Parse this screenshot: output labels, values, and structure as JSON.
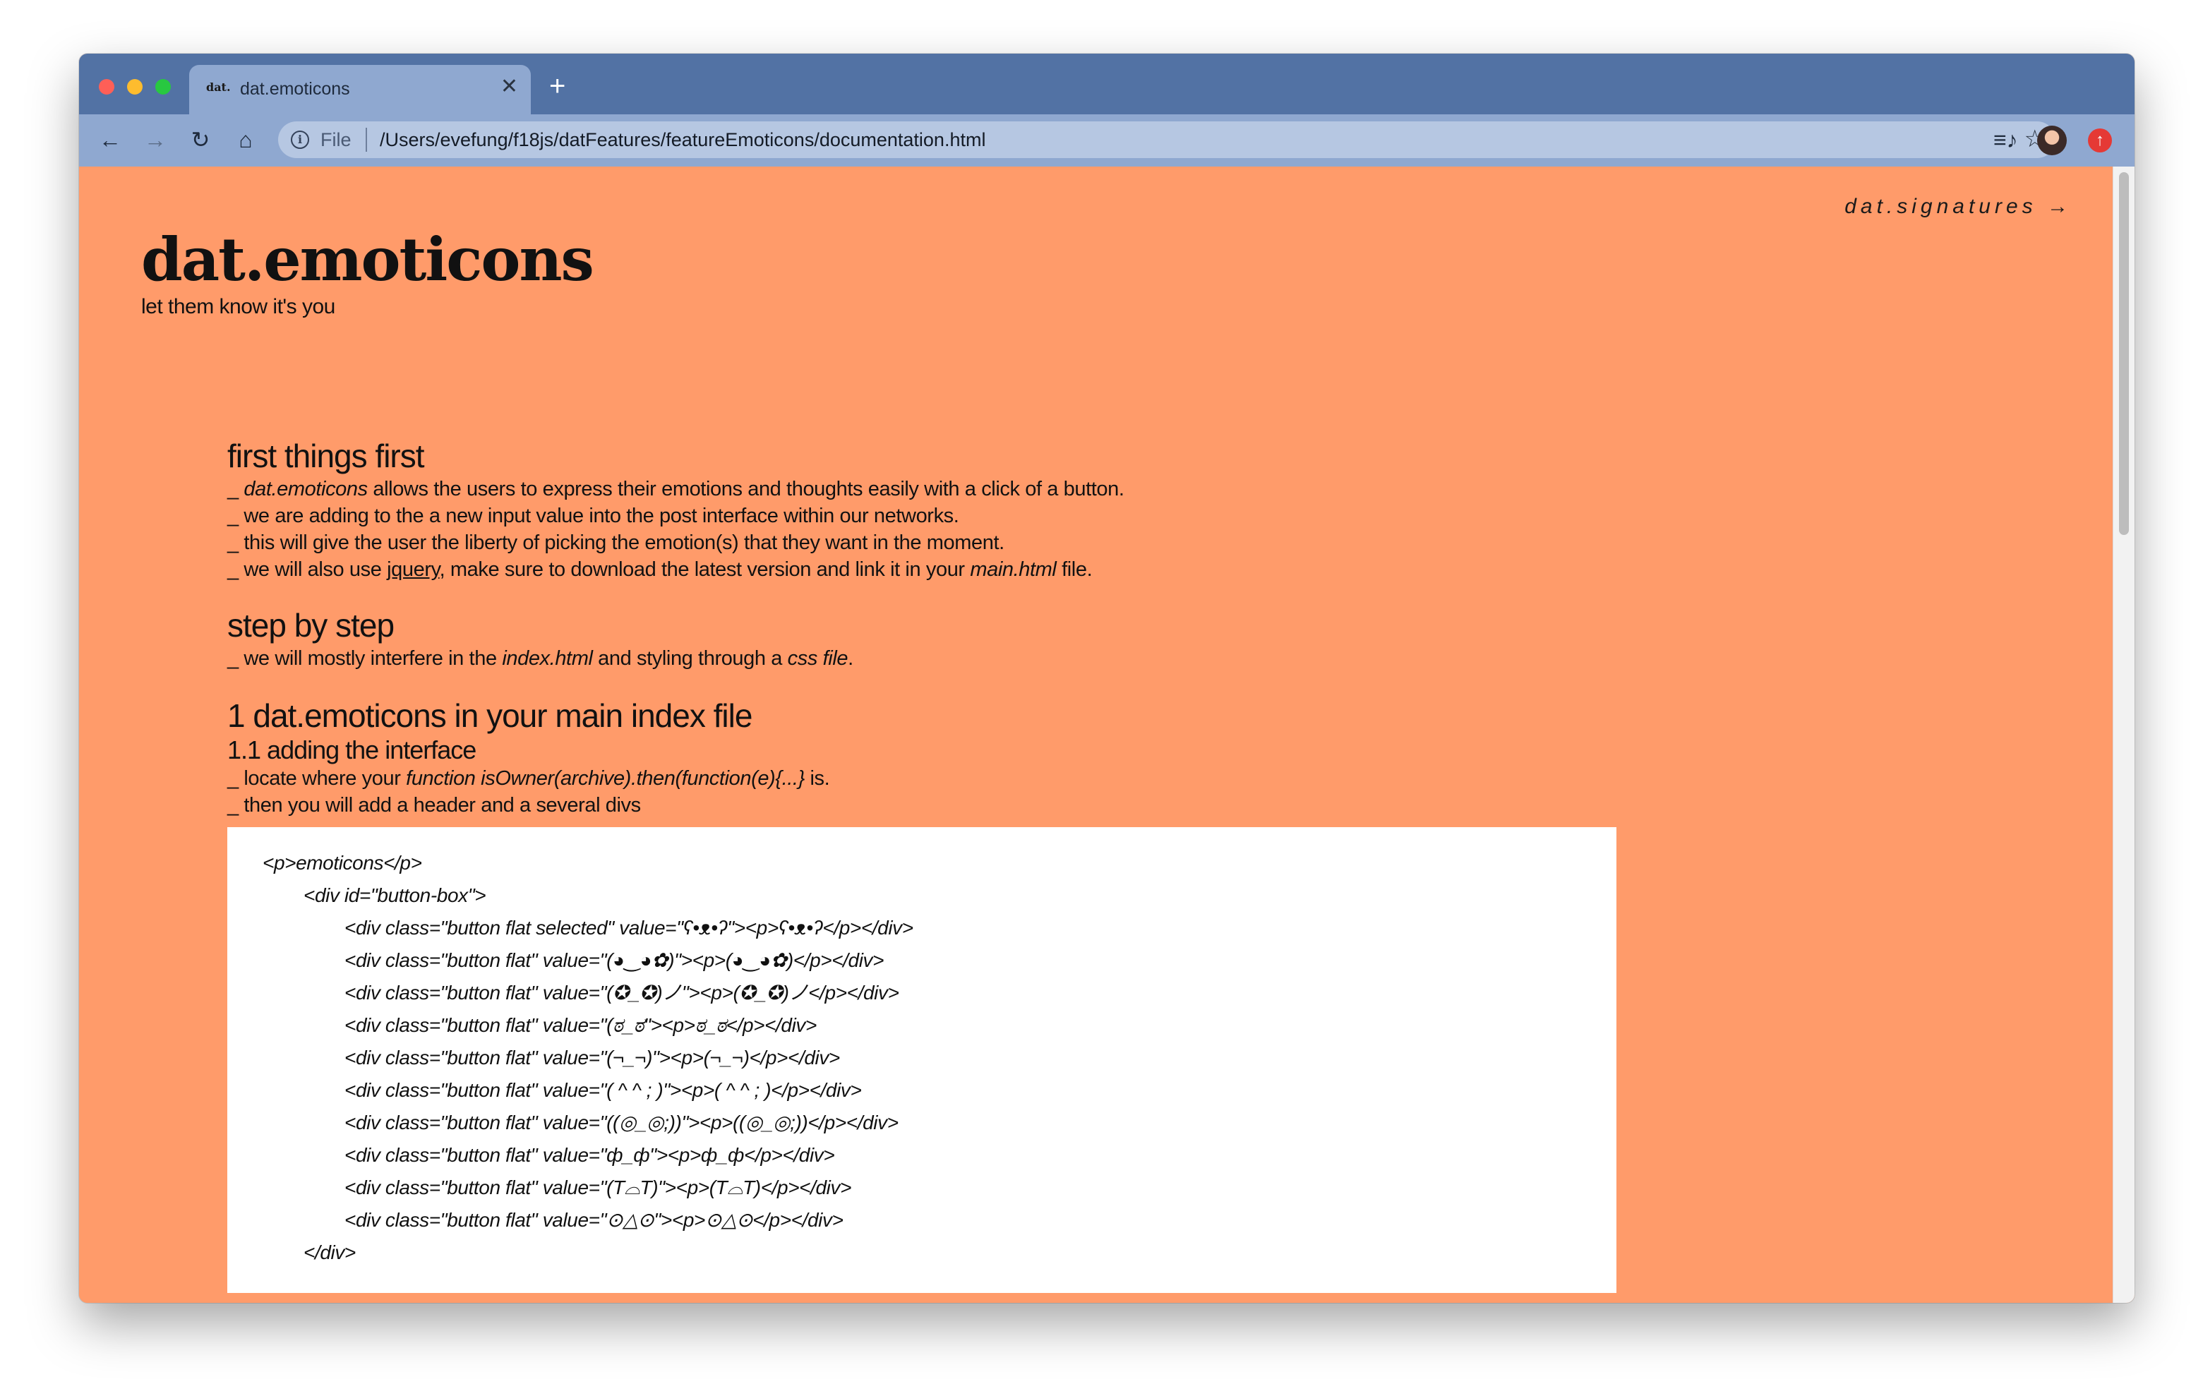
{
  "browser": {
    "tab": {
      "favicon_text": "dat.",
      "title": "dat.emoticons",
      "close_label": "✕"
    },
    "new_tab_label": "+",
    "nav": {
      "back": "←",
      "forward": "→",
      "reload": "↻",
      "home": "⌂"
    },
    "address": {
      "scheme_label": "File",
      "url": "/Users/evefung/f18js/datFeatures/featureEmoticons/documentation.html"
    },
    "icons": {
      "info": "i",
      "star": "☆",
      "playlist": "≡♪",
      "update": "↑"
    }
  },
  "page": {
    "top_link": "dat.signatures →",
    "title": "dat.emoticons",
    "tagline": "let them know it's you",
    "sections": {
      "first": {
        "heading": "first things first",
        "l1_prefix": "_ ",
        "l1_em": "dat.emoticons",
        "l1_rest": " allows the users to express their emotions and thoughts easily with a click of a button.",
        "l2": "_ we are adding to the a new input value into the post interface within our networks.",
        "l3": "_ this will give the user the liberty of picking the emotion(s) that they want in the moment.",
        "l4_a": "_ we will also use ",
        "l4_link": "jquery",
        "l4_b": ", make sure to download the latest version and link it in your ",
        "l4_em": "main.html",
        "l4_c": " file."
      },
      "step": {
        "heading": "step by step",
        "l1_a": "_ we will mostly interfere in the ",
        "l1_em1": "index.html",
        "l1_b": " and styling through a ",
        "l1_em2": "css file",
        "l1_c": "."
      },
      "one": {
        "heading": "1 dat.emoticons in your main index file",
        "subheading": "1.1 adding the interface",
        "l1_a": "_ locate where your ",
        "l1_em": "function isOwner(archive).then(function(e){...}",
        "l1_b": " is.",
        "l2": "_ then you will add a header and a several divs"
      }
    },
    "code_lines": [
      "<p>emoticons</p>",
      "<div id=\"button-box\">",
      "<div class=\"button flat selected\" value=\"ʕ•ᴥ•ʔ\"><p>ʕ•ᴥ•ʔ</p></div>",
      "<div class=\"button flat\" value=\"(◕‿◕✿)\"><p>(◕‿◕✿)</p></div>",
      "<div class=\"button flat\" value=\"(✪_✪)ノ\"><p>(✪_✪)ノ</p></div>",
      "<div class=\"button flat\" value=\"(ಠ_ಠ\"><p>ಠ_ಠ</p></div>",
      "<div class=\"button flat\" value=\"(¬_¬)\"><p>(¬_¬)</p></div>",
      "<div class=\"button flat\" value=\"( ^ ^ ; )\"><p>( ^ ^ ; )</p></div>",
      "<div class=\"button flat\" value=\"((◎_◎;))\"><p>((◎_◎;))</p></div>",
      "<div class=\"button flat\" value=\"ф_ф\"><p>ф_ф</p></div>",
      "<div class=\"button flat\" value=\"(T⌓T)\"><p>(T⌓T)</p></div>",
      "<div class=\"button flat\" value=\"⊙△⊙\"><p>⊙△⊙</p></div>",
      "</div>"
    ]
  }
}
